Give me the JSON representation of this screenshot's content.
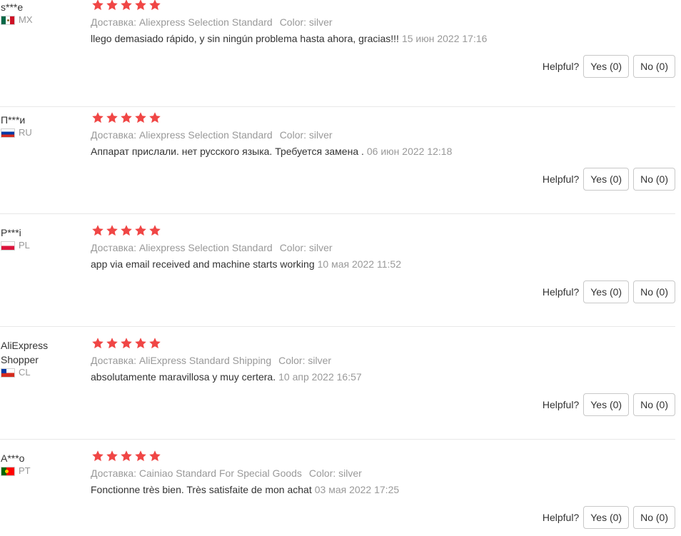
{
  "helpful_label": "Helpful?",
  "colors": {
    "star": "#f04645",
    "meta_gray": "#999999",
    "text": "#333333"
  },
  "reviews": [
    {
      "user": "s***e",
      "country_code": "MX",
      "flag": "flag-mexico",
      "stars": 5,
      "shipping": "Доставка: Aliexpress Selection Standard",
      "color": "Color: silver",
      "text": "llego demasiado rápido, y sin ningún problema hasta ahora, gracias!!!",
      "date": "15 июн 2022 17:16",
      "yes": "Yes (0)",
      "no": "No (0)"
    },
    {
      "user": "П***и",
      "country_code": "RU",
      "flag": "flag-russia",
      "stars": 5,
      "shipping": "Доставка: Aliexpress Selection Standard",
      "color": "Color: silver",
      "text": "Аппарат прислали. нет русского языка. Требуется замена .",
      "date": "06 июн 2022 12:18",
      "yes": "Yes (0)",
      "no": "No (0)"
    },
    {
      "user": "P***i",
      "country_code": "PL",
      "flag": "flag-poland",
      "stars": 5,
      "shipping": "Доставка: Aliexpress Selection Standard",
      "color": "Color: silver",
      "text": "app via email received and machine starts working",
      "date": "10 мая 2022 11:52",
      "yes": "Yes (0)",
      "no": "No (0)"
    },
    {
      "user": "AliExpress Shopper",
      "country_code": "CL",
      "flag": "flag-chile",
      "stars": 5,
      "shipping": "Доставка: AliExpress Standard Shipping",
      "color": "Color: silver",
      "text": "absolutamente maravillosa y muy certera.",
      "date": "10 апр 2022 16:57",
      "yes": "Yes (0)",
      "no": "No (0)"
    },
    {
      "user": "A***o",
      "country_code": "PT",
      "flag": "flag-portugal",
      "stars": 5,
      "shipping": "Доставка: Cainiao Standard For Special Goods",
      "color": "Color: silver",
      "text": "Fonctionne très bien. Très satisfaite de mon achat",
      "date": "03 мая 2022 17:25",
      "yes": "Yes (0)",
      "no": "No (0)"
    }
  ]
}
